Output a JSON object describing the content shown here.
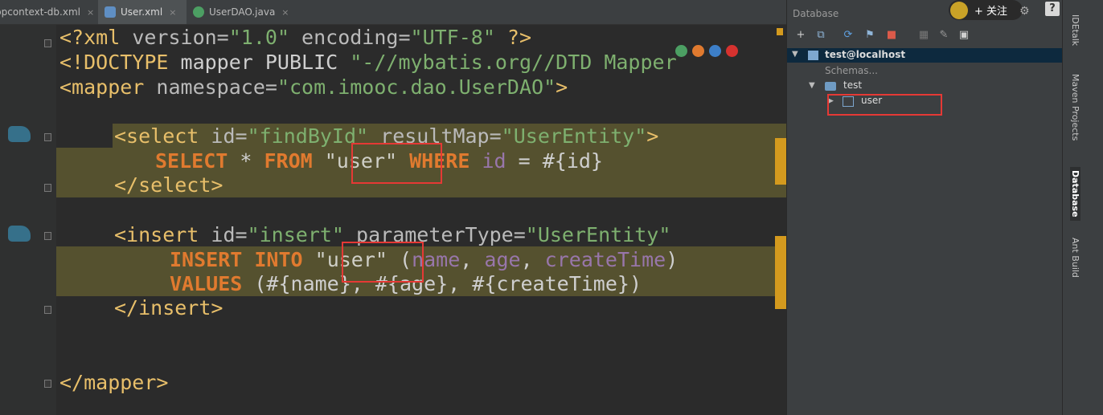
{
  "tabs": [
    {
      "label": "ppcontext-db.xml",
      "color": "#c77d3a",
      "active": false
    },
    {
      "label": "User.xml",
      "color": "#5f8fc4",
      "active": true
    },
    {
      "label": "UserDAO.java",
      "color": "#4c9f63",
      "active": false
    }
  ],
  "tab_close_glyph": "×",
  "code": {
    "l1": {
      "open": "<?xml",
      "a1": " version=",
      "v1": "\"1.0\"",
      "a2": " encoding=",
      "v2": "\"UTF-8\"",
      "close": " ?>"
    },
    "l2": {
      "open": "<!DOCTYPE",
      "txt": " mapper PUBLIC ",
      "str": "\"-//mybatis.org//DTD Mapper"
    },
    "l3": {
      "open": "<mapper",
      "a1": " namespace=",
      "v1": "\"com.imooc.dao.UserDAO\"",
      "close": ">"
    },
    "l5": {
      "open": "<select",
      "a1": " id=",
      "v1": "\"findById\"",
      "a2": " resultMap=",
      "v2": "\"UserEntity\"",
      "close": ">"
    },
    "l6": {
      "kw1": "SELECT",
      "t1": " * ",
      "kw2": "FROM",
      "t2": " ",
      "s1": "\"user\"",
      "t3": " ",
      "kw3": "WHERE",
      "t4": " ",
      "c1": "id",
      "t5": " = #{id}"
    },
    "l7": {
      "close": "</select>"
    },
    "l9": {
      "open": "<insert",
      "a1": " id=",
      "v1": "\"insert\"",
      "a2": " parameterType=",
      "v2": "\"UserEntity\"",
      "more": " ↵"
    },
    "l10": {
      "kw1": "INSERT",
      "t1": " ",
      "kw2": "INTO",
      "t2": " ",
      "s1": "\"user\"",
      "t3": " (",
      "c1": "name",
      "t4": ", ",
      "c2": "age",
      "t5": ", ",
      "c3": "createTime",
      "t6": ")"
    },
    "l11": {
      "kw1": "VALUES",
      "t1": " (#{name}, #{age}, #{createTime})"
    },
    "l12": {
      "close": "</insert>"
    },
    "l15": {
      "close": "</mapper>"
    }
  },
  "browser_icons": [
    "chrome-icon",
    "firefox-icon",
    "safari-icon",
    "opera-icon"
  ],
  "database": {
    "title": "Database",
    "toolbar": [
      {
        "name": "add-icon",
        "glyph": "+"
      },
      {
        "name": "copy-icon",
        "glyph": "⧉"
      },
      {
        "name": "refresh-icon",
        "glyph": "⟳"
      },
      {
        "name": "filter-icon",
        "glyph": "⚑"
      },
      {
        "name": "stop-icon",
        "glyph": "■"
      },
      {
        "name": "table-icon",
        "glyph": "▦"
      },
      {
        "name": "edit-icon",
        "glyph": "✎"
      },
      {
        "name": "console-icon",
        "glyph": "▣"
      }
    ],
    "tree": {
      "connection": "test@localhost",
      "schemas": "Schemas...",
      "schema": "test",
      "table": "user"
    }
  },
  "tool_strip": [
    "IDEtalk",
    "Maven Projects",
    "Database",
    "Ant Build"
  ],
  "overlay": {
    "follow": "+ 关注",
    "help": "?"
  }
}
